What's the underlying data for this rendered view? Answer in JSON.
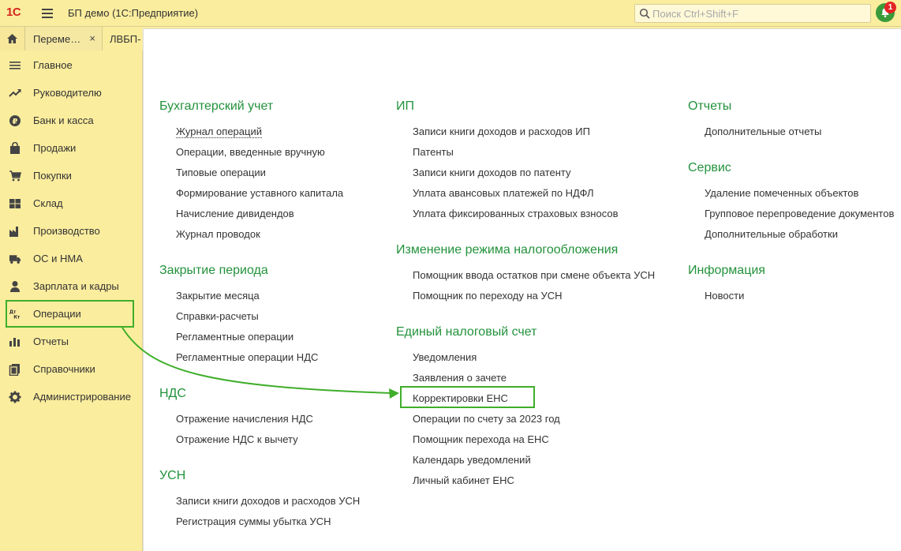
{
  "app": {
    "logo": "1С",
    "title": "БП демо  (1С:Предприятие)"
  },
  "search": {
    "placeholder": "Поиск Ctrl+Shift+F"
  },
  "notifications": {
    "count": "1"
  },
  "tabs": [
    {
      "label": "Переме…",
      "close": "×"
    },
    {
      "label": "ЛВБП-"
    }
  ],
  "sidebar": {
    "items": [
      {
        "label": "Главное",
        "icon": "menu-icon"
      },
      {
        "label": "Руководителю",
        "icon": "trend-icon"
      },
      {
        "label": "Банк и касса",
        "icon": "ruble-icon"
      },
      {
        "label": "Продажи",
        "icon": "bag-icon"
      },
      {
        "label": "Покупки",
        "icon": "cart-icon"
      },
      {
        "label": "Склад",
        "icon": "grid-icon"
      },
      {
        "label": "Производство",
        "icon": "factory-icon"
      },
      {
        "label": "ОС и НМА",
        "icon": "truck-icon"
      },
      {
        "label": "Зарплата и кадры",
        "icon": "person-icon"
      },
      {
        "label": "Операции",
        "icon": "dt-kt-icon",
        "active": true
      },
      {
        "label": "Отчеты",
        "icon": "chart-icon"
      },
      {
        "label": "Справочники",
        "icon": "books-icon"
      },
      {
        "label": "Администрирование",
        "icon": "gear-icon"
      }
    ]
  },
  "sections": {
    "accounting": {
      "title": "Бухгалтерский учет",
      "links": [
        "Журнал операций",
        "Операции, введенные вручную",
        "Типовые операции",
        "Формирование уставного капитала",
        "Начисление дивидендов",
        "Журнал проводок"
      ]
    },
    "closing": {
      "title": "Закрытие периода",
      "links": [
        "Закрытие месяца",
        "Справки-расчеты",
        "Регламентные операции",
        "Регламентные операции НДС"
      ]
    },
    "vat": {
      "title": "НДС",
      "links": [
        "Отражение начисления НДС",
        "Отражение НДС к вычету"
      ]
    },
    "usn": {
      "title": "УСН",
      "links": [
        "Записи книги доходов и расходов УСН",
        "Регистрация суммы убытка УСН"
      ]
    },
    "ip": {
      "title": "ИП",
      "links": [
        "Записи книги доходов и расходов ИП",
        "Патенты",
        "Записи книги доходов по патенту",
        "Уплата авансовых платежей по НДФЛ",
        "Уплата фиксированных страховых взносов"
      ]
    },
    "tax_mode": {
      "title": "Изменение режима налогообложения",
      "links": [
        "Помощник ввода остатков при смене объекта УСН",
        "Помощник по переходу на УСН"
      ]
    },
    "ens": {
      "title": "Единый налоговый счет",
      "links": [
        "Уведомления",
        "Заявления о зачете",
        "Корректировки ЕНС",
        "Операции по счету за 2023 год",
        "Помощник перехода на ЕНС",
        "Календарь уведомлений",
        "Личный кабинет ЕНС"
      ]
    },
    "reports": {
      "title": "Отчеты",
      "links": [
        "Дополнительные отчеты"
      ]
    },
    "service": {
      "title": "Сервис",
      "links": [
        "Удаление помеченных объектов",
        "Групповое перепроведение документов",
        "Дополнительные обработки"
      ]
    },
    "info": {
      "title": "Информация",
      "links": [
        "Новости"
      ]
    }
  },
  "colors": {
    "bar": "#fbed9e",
    "section_title": "#23923c",
    "highlight": "#3fae2a",
    "logo": "#d6251f"
  }
}
